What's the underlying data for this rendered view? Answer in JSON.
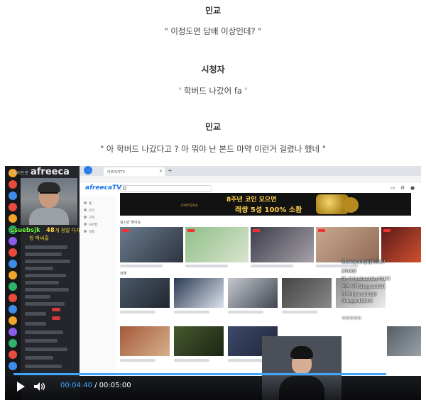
{
  "article": {
    "lines": [
      {
        "speaker": "민교",
        "text": "\" 이정도면 담배 이상인데? \""
      },
      {
        "speaker": "시청자",
        "text": "' 학버드 나갔어 fa '"
      },
      {
        "speaker": "민교",
        "text": "\" 아 학버드 나갔다고 ? 아 뭐야 난 본드 마약 이런거 걸렸나 했네 \""
      }
    ]
  },
  "video": {
    "player": {
      "current_time": "00:04:40",
      "separator": " / ",
      "duration": "00:05:00",
      "progress": 0.9333
    },
    "stream_overlay": {
      "logo": "afreeca",
      "logo_prefix": "< 메이트봇",
      "username": "ssuebsjk",
      "count": "48",
      "sub_text": "개 정말 다채팅",
      "sub_text2": "창 박씨홍"
    },
    "browser": {
      "tab_title": "아프리카TV",
      "site_logo": "afreecaTV",
      "banner_line1": "8주년 코인 모으면",
      "banner_line2": "래쌍 5성 100% 소환",
      "banner_brand": "com2us",
      "section_live": "실시간 핫이슈",
      "section_all": "전체",
      "nav_items": [
        "홈",
        "인기",
        "구독",
        "보관함",
        "설정"
      ]
    },
    "chat": [
      {
        "user": "isloveyouhyejin1037",
        "text": ""
      },
      {
        "user": "2018년",
        "text": ""
      },
      {
        "user": "야, 나",
        "text": "hoshee(sky7017)"
      },
      {
        "user": "",
        "text": "혼돈 사약(skygood03)"
      },
      {
        "user": "",
        "text": "다이아(janeb818)"
      },
      {
        "user": "",
        "text": "(kinggod1234)"
      },
      {
        "user": "",
        "text": "ㅋㅋㅋㅋㅋ"
      }
    ],
    "colors": {
      "progress": "#3ea6ff",
      "chat_name_green": "#7dff4d",
      "overlay_yellow": "#ffe14d"
    }
  }
}
